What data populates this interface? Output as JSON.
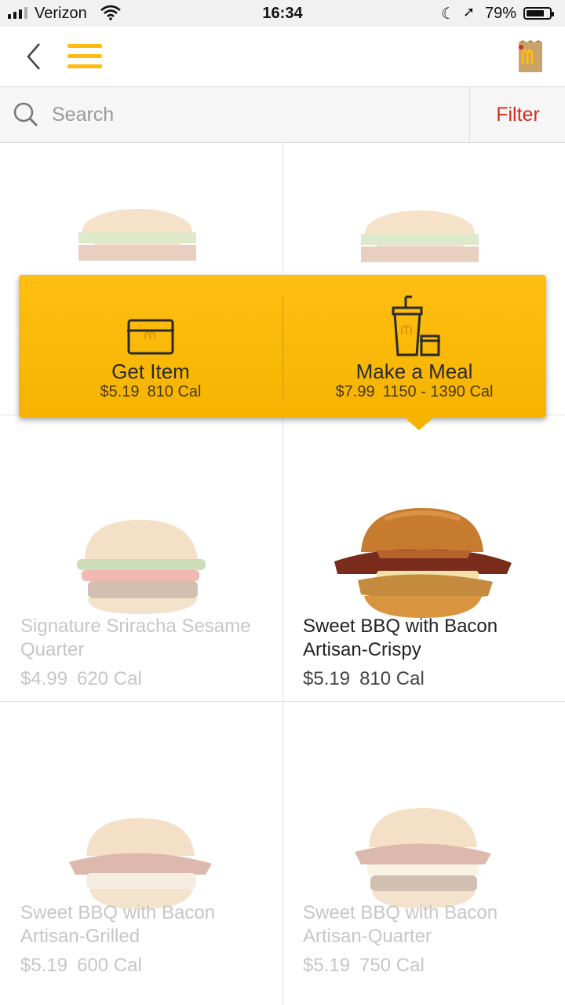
{
  "status_bar": {
    "carrier": "Verizon",
    "time": "16:34",
    "battery_percent": "79%",
    "battery_level": 0.79,
    "icons": [
      "signal-icon",
      "wifi-icon",
      "moon-icon",
      "location-arrow-icon",
      "battery-icon"
    ]
  },
  "header": {
    "back_icon": "chevron-left-icon",
    "menu_icon": "hamburger-menu-icon",
    "bag_icon": "mcdonalds-bag-icon"
  },
  "search": {
    "placeholder": "Search",
    "value": "",
    "filter_label": "Filter"
  },
  "popover": {
    "options": [
      {
        "title": "Get Item",
        "price": "$5.19",
        "calories": "810 Cal",
        "icon": "box-icon"
      },
      {
        "title": "Make a Meal",
        "price": "$7.99",
        "calories": "1150 - 1390 Cal",
        "icon": "meal-drink-icon"
      }
    ]
  },
  "items": [
    {
      "name": "",
      "price": "",
      "calories": "",
      "image": "burger-image"
    },
    {
      "name": "",
      "price": "",
      "calories": "",
      "image": "burger-image"
    },
    {
      "name": "Signature Sriracha Sesame Quarter",
      "price": "$4.99",
      "calories": "620 Cal",
      "image": "burger-image"
    },
    {
      "name": "Sweet BBQ with Bacon Artisan-Crispy",
      "price": "$5.19",
      "calories": "810 Cal",
      "image": "crispy-chicken-sandwich-image"
    },
    {
      "name": "Sweet BBQ with Bacon Artisan-Grilled",
      "price": "$5.19",
      "calories": "600 Cal",
      "image": "grilled-chicken-sandwich-image"
    },
    {
      "name": "Sweet BBQ with Bacon Artisan-Quarter",
      "price": "$5.19",
      "calories": "750 Cal",
      "image": "quarter-burger-image"
    }
  ],
  "colors": {
    "accent_yellow": "#ffbc0d",
    "filter_red": "#d52b1e"
  }
}
